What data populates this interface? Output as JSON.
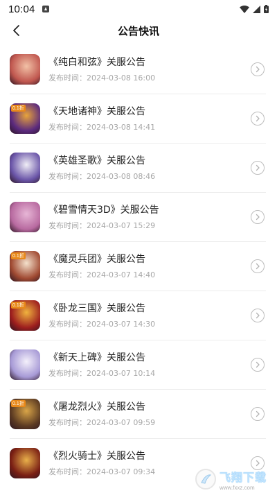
{
  "status": {
    "time": "10:04"
  },
  "header": {
    "title": "公告快讯"
  },
  "announcements": [
    {
      "title": "《纯白和弦》关服公告",
      "time": "发布时间：2024-03-08 16:00",
      "icon": "game-thumb-chunbaihexian",
      "bg": "#c0574f",
      "accent": "#f2c1a6"
    },
    {
      "title": "《天地诸神》关服公告",
      "time": "发布时间：2024-03-08 14:41",
      "icon": "game-thumb-tiandizhushen",
      "bg": "#5b2a7e",
      "accent": "#e8a43a",
      "badge_top": "0.1折"
    },
    {
      "title": "《英雄圣歌》关服公告",
      "time": "发布时间：2024-03-08 08:46",
      "icon": "game-thumb-yingxiongshengge",
      "bg": "#6a55a8",
      "accent": "#f0eef6"
    },
    {
      "title": "《碧雪情天3D》关服公告",
      "time": "发布时间：2024-03-07 15:29",
      "icon": "game-thumb-bixueqingtian",
      "bg": "#b86aa0",
      "accent": "#e7b6d6"
    },
    {
      "title": "《魔灵兵团》关服公告",
      "time": "发布时间：2024-03-07 14:40",
      "icon": "game-thumb-molingbingtuan",
      "bg": "#a04a32",
      "accent": "#f4e1cc",
      "badge_top": "0.1折"
    },
    {
      "title": "《卧龙三国》关服公告",
      "time": "发布时间：2024-03-07 14:30",
      "icon": "game-thumb-wolongsanguo",
      "bg": "#9d1e1e",
      "accent": "#f0b33e",
      "badge_top": "0.1折"
    },
    {
      "title": "《新天上碑》关服公告",
      "time": "发布时间：2024-03-07 10:14",
      "icon": "game-thumb-xintianshangbei",
      "bg": "#a79ad6",
      "accent": "#f4f0fb"
    },
    {
      "title": "《屠龙烈火》关服公告",
      "time": "发布时间：2024-03-07 09:59",
      "icon": "game-thumb-tulonglie",
      "bg": "#5b3a22",
      "accent": "#d9a548",
      "badge_top": "0.1折"
    },
    {
      "title": "《烈火骑士》关服公告",
      "time": "发布时间：2024-03-07 09:34",
      "icon": "game-thumb-liehuoqishi",
      "bg": "#7a1f14",
      "accent": "#e9b04a"
    }
  ],
  "watermark": {
    "main": "飞翔下载",
    "sub": "www.fxxz.com"
  }
}
